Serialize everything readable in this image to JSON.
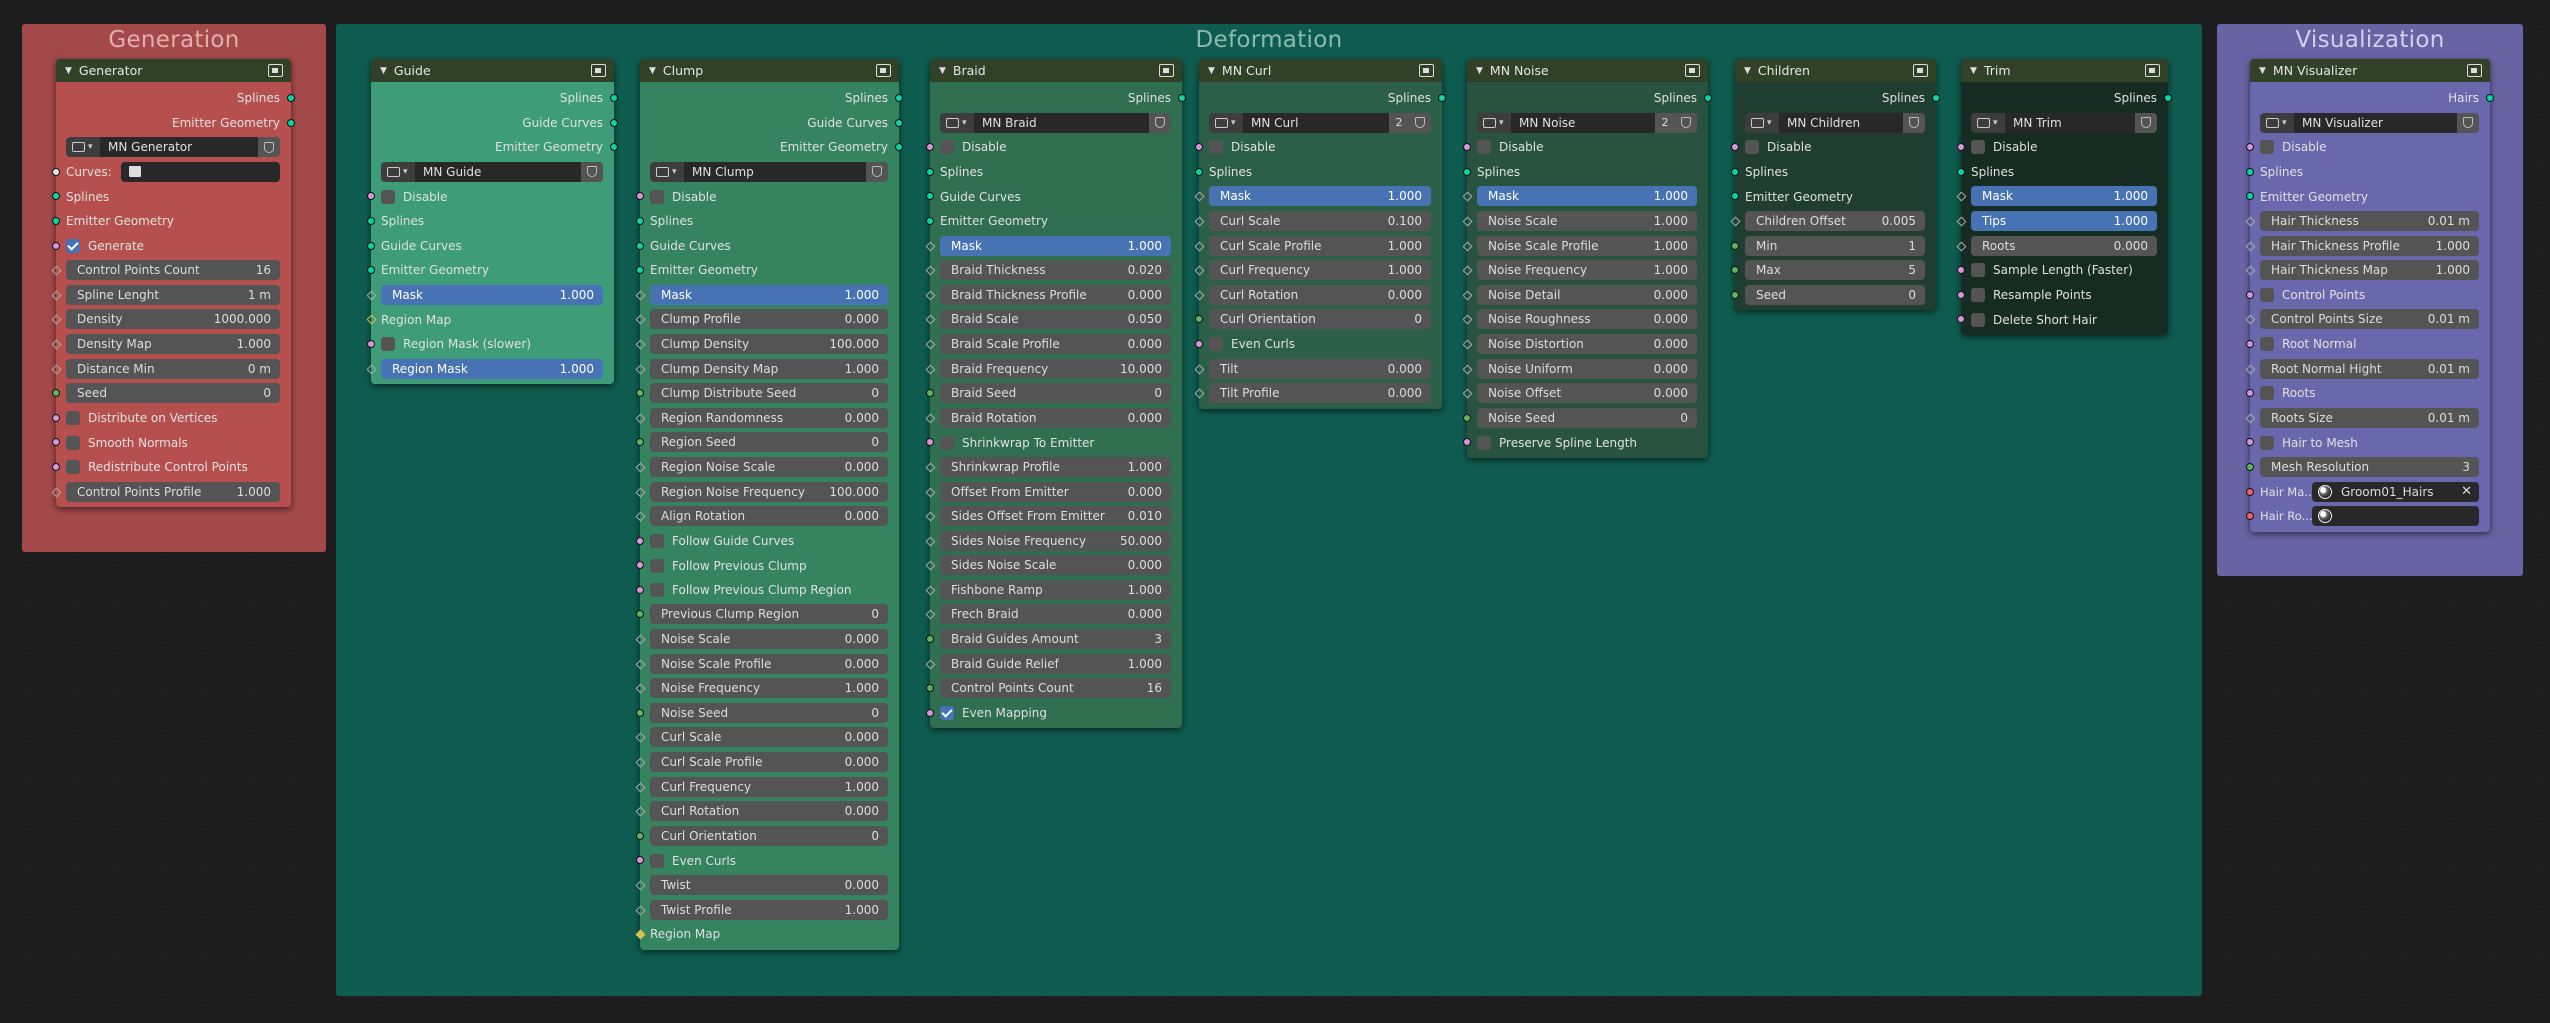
{
  "colors": {
    "frame_generation": "#a4494b",
    "frame_deformation": "#0e5c4f",
    "frame_visualization": "#6864a4",
    "node_generator": "#b5504f",
    "node_guide": "#3e9c79",
    "node_clump": "#36835f",
    "node_braid": "#2f6e4f",
    "node_curl": "#2c5f47",
    "node_noise": "#28543f",
    "node_children": "#1f3e31",
    "node_trim": "#162b21",
    "node_visualizer": "#6968ad",
    "header": "#304128",
    "accent_blue": "#4772b3"
  },
  "frames": {
    "generation": "Generation",
    "deformation": "Deformation",
    "visualization": "Visualization"
  },
  "icons": {
    "node_header": "node-group-icon",
    "collapse": "chevron-down-icon",
    "group": "node-tree-icon",
    "shield": "fake-user-shield-icon",
    "object": "object-icon",
    "material": "material-icon",
    "clear": "close-icon"
  },
  "generator": {
    "title": "Generator",
    "out_splines": "Splines",
    "out_emitter": "Emitter Geometry",
    "group_name": "MN Generator",
    "curves_label": "Curves:",
    "in_splines": "Splines",
    "in_emitter": "Emitter Geometry",
    "generate": "Generate",
    "generate_checked": true,
    "fields": [
      {
        "label": "Control Points Count",
        "value": "16"
      },
      {
        "label": "Spline Lenght",
        "value": "1 m"
      },
      {
        "label": "Density",
        "value": "1000.000"
      },
      {
        "label": "Density Map",
        "value": "1.000"
      },
      {
        "label": "Distance Min",
        "value": "0 m"
      },
      {
        "label": "Seed",
        "value": "0"
      }
    ],
    "checks": [
      "Distribute on Vertices",
      "Smooth Normals",
      "Redistribute Control Points"
    ],
    "last_field": {
      "label": "Control Points Profile",
      "value": "1.000"
    }
  },
  "guide": {
    "title": "Guide",
    "outputs": [
      "Splines",
      "Guide Curves",
      "Emitter Geometry"
    ],
    "group_name": "MN Guide",
    "disable": "Disable",
    "in_splines": "Splines",
    "in_guide_curves": "Guide Curves",
    "in_emitter": "Emitter Geometry",
    "mask": {
      "label": "Mask",
      "value": "1.000"
    },
    "region_map": "Region Map",
    "region_mask_slower": "Region Mask (slower)",
    "region_mask": {
      "label": "Region Mask",
      "value": "1.000"
    }
  },
  "clump": {
    "title": "Clump",
    "outputs": [
      "Splines",
      "Guide Curves",
      "Emitter Geometry"
    ],
    "group_name": "MN Clump",
    "disable": "Disable",
    "in_splines": "Splines",
    "in_guide_curves": "Guide Curves",
    "in_emitter": "Emitter Geometry",
    "mask": {
      "label": "Mask",
      "value": "1.000"
    },
    "fields_a": [
      {
        "label": "Clump Profile",
        "value": "0.000"
      },
      {
        "label": "Clump Density",
        "value": "100.000"
      },
      {
        "label": "Clump Density Map",
        "value": "1.000"
      },
      {
        "label": "Clump Distribute Seed",
        "value": "0"
      },
      {
        "label": "Region Randomness",
        "value": "0.000"
      },
      {
        "label": "Region Seed",
        "value": "0"
      },
      {
        "label": "Region Noise Scale",
        "value": "0.000"
      },
      {
        "label": "Region Noise Frequency",
        "value": "100.000"
      },
      {
        "label": "Align Rotation",
        "value": "0.000"
      }
    ],
    "checks": [
      "Follow Guide Curves",
      "Follow Previous Clump",
      "Follow Previous Clump Region"
    ],
    "fields_b": [
      {
        "label": "Previous Clump Region",
        "value": "0"
      },
      {
        "label": "Noise Scale",
        "value": "0.000"
      },
      {
        "label": "Noise Scale Profile",
        "value": "0.000"
      },
      {
        "label": "Noise Frequency",
        "value": "1.000"
      },
      {
        "label": "Noise Seed",
        "value": "0"
      },
      {
        "label": "Curl Scale",
        "value": "0.000"
      },
      {
        "label": "Curl Scale Profile",
        "value": "0.000"
      },
      {
        "label": "Curl Frequency",
        "value": "1.000"
      },
      {
        "label": "Curl Rotation",
        "value": "0.000"
      },
      {
        "label": "Curl Orientation",
        "value": "0"
      }
    ],
    "even_curls": "Even Curls",
    "fields_c": [
      {
        "label": "Twist",
        "value": "0.000"
      },
      {
        "label": "Twist Profile",
        "value": "1.000"
      }
    ],
    "region_map": "Region Map"
  },
  "braid": {
    "title": "Braid",
    "out_splines": "Splines",
    "group_name": "MN Braid",
    "disable": "Disable",
    "in_splines": "Splines",
    "in_guide_curves": "Guide Curves",
    "in_emitter": "Emitter Geometry",
    "mask": {
      "label": "Mask",
      "value": "1.000"
    },
    "fields_a": [
      {
        "label": "Braid Thickness",
        "value": "0.020"
      },
      {
        "label": "Braid Thickness Profile",
        "value": "0.000"
      },
      {
        "label": "Braid Scale",
        "value": "0.050"
      },
      {
        "label": "Braid Scale Profile",
        "value": "0.000"
      },
      {
        "label": "Braid Frequency",
        "value": "10.000"
      },
      {
        "label": "Braid Seed",
        "value": "0"
      },
      {
        "label": "Braid Rotation",
        "value": "0.000"
      }
    ],
    "shrinkwrap": "Shrinkwrap To Emitter",
    "fields_b": [
      {
        "label": "Shrinkwrap Profile",
        "value": "1.000"
      },
      {
        "label": "Offset From Emitter",
        "value": "0.000"
      },
      {
        "label": "Sides Offset From Emitter",
        "value": "0.010"
      },
      {
        "label": "Sides Noise Frequency",
        "value": "50.000"
      },
      {
        "label": "Sides Noise Scale",
        "value": "0.000"
      },
      {
        "label": "Fishbone Ramp",
        "value": "1.000"
      },
      {
        "label": "Frech Braid",
        "value": "0.000"
      },
      {
        "label": "Braid Guides Amount",
        "value": "3"
      },
      {
        "label": "Braid Guide Relief",
        "value": "1.000"
      },
      {
        "label": "Control Points Count",
        "value": "16"
      }
    ],
    "even_mapping": "Even Mapping",
    "even_mapping_checked": true
  },
  "curl": {
    "title": "MN Curl",
    "out_splines": "Splines",
    "group_name": "MN Curl",
    "users": "2",
    "disable": "Disable",
    "in_splines": "Splines",
    "mask": {
      "label": "Mask",
      "value": "1.000"
    },
    "fields_a": [
      {
        "label": "Curl Scale",
        "value": "0.100"
      },
      {
        "label": "Curl Scale Profile",
        "value": "1.000"
      },
      {
        "label": "Curl Frequency",
        "value": "1.000"
      },
      {
        "label": "Curl Rotation",
        "value": "0.000"
      },
      {
        "label": "Curl Orientation",
        "value": "0"
      }
    ],
    "even_curls": "Even Curls",
    "fields_b": [
      {
        "label": "Tilt",
        "value": "0.000"
      },
      {
        "label": "Tilt Profile",
        "value": "0.000"
      }
    ]
  },
  "noise": {
    "title": "MN Noise",
    "out_splines": "Splines",
    "group_name": "MN Noise",
    "users": "2",
    "disable": "Disable",
    "in_splines": "Splines",
    "mask": {
      "label": "Mask",
      "value": "1.000"
    },
    "fields": [
      {
        "label": "Noise Scale",
        "value": "1.000"
      },
      {
        "label": "Noise Scale Profile",
        "value": "1.000"
      },
      {
        "label": "Noise Frequency",
        "value": "1.000"
      },
      {
        "label": "Noise Detail",
        "value": "0.000"
      },
      {
        "label": "Noise Roughness",
        "value": "0.000"
      },
      {
        "label": "Noise Distortion",
        "value": "0.000"
      },
      {
        "label": "Noise Uniform",
        "value": "0.000"
      },
      {
        "label": "Noise Offset",
        "value": "0.000"
      },
      {
        "label": "Noise Seed",
        "value": "0"
      }
    ],
    "preserve": "Preserve Spline Length"
  },
  "children": {
    "title": "Children",
    "out_splines": "Splines",
    "group_name": "MN Children",
    "disable": "Disable",
    "in_splines": "Splines",
    "in_emitter": "Emitter Geometry",
    "fields": [
      {
        "label": "Children Offset",
        "value": "0.005"
      },
      {
        "label": "Min",
        "value": "1"
      },
      {
        "label": "Max",
        "value": "5"
      },
      {
        "label": "Seed",
        "value": "0"
      }
    ]
  },
  "trim": {
    "title": "Trim",
    "out_splines": "Splines",
    "group_name": "MN Trim",
    "disable": "Disable",
    "in_splines": "Splines",
    "mask": {
      "label": "Mask",
      "value": "1.000"
    },
    "tips": {
      "label": "Tips",
      "value": "1.000"
    },
    "roots": {
      "label": "Roots",
      "value": "0.000"
    },
    "checks": [
      "Sample Length (Faster)",
      "Resample Points",
      "Delete Short Hair"
    ]
  },
  "visualizer": {
    "title": "MN Visualizer",
    "out_hairs": "Hairs",
    "group_name": "MN Visualizer",
    "disable": "Disable",
    "in_splines": "Splines",
    "in_emitter": "Emitter Geometry",
    "fields_a": [
      {
        "label": "Hair Thickness",
        "value": "0.01 m"
      },
      {
        "label": "Hair Thickness Profile",
        "value": "1.000"
      },
      {
        "label": "Hair Thickness Map",
        "value": "1.000"
      }
    ],
    "control_points": "Control Points",
    "control_points_size": {
      "label": "Control Points Size",
      "value": "0.01 m"
    },
    "root_normal": "Root Normal",
    "root_normal_hight": {
      "label": "Root Normal Hight",
      "value": "0.01 m"
    },
    "roots": "Roots",
    "roots_size": {
      "label": "Roots Size",
      "value": "0.01 m"
    },
    "hair_to_mesh": "Hair to Mesh",
    "mesh_resolution": {
      "label": "Mesh Resolution",
      "value": "3"
    },
    "hair_mat_label": "Hair Ma...",
    "hair_mat_value": "Groom01_Hairs",
    "hair_ro_label": "Hair Ro..."
  }
}
